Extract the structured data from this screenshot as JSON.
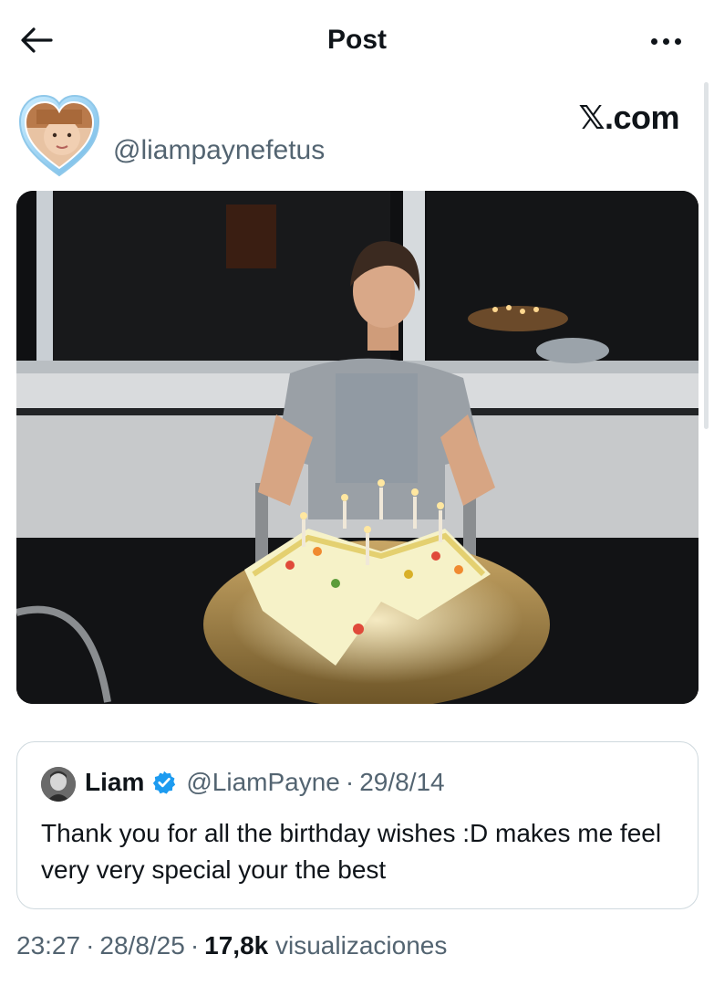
{
  "header": {
    "title": "Post",
    "back_icon": "arrow-left-icon",
    "more_icon": "more-horizontal-icon"
  },
  "author": {
    "handle": "@liampaynefetus",
    "avatar": "heart-frame-avatar"
  },
  "brand": "𝕏.com",
  "photo": {
    "subject": "birthday-cake-photo"
  },
  "quoted_post": {
    "name": "Liam",
    "verified": true,
    "handle": "@LiamPayne",
    "separator": "·",
    "date": "29/8/14",
    "text": "Thank you for all the birthday wishes :D makes me feel very very special your the best"
  },
  "meta": {
    "time": "23:27",
    "separator": "·",
    "date": "28/8/25",
    "views_count": "17,8k",
    "views_label": "visualizaciones"
  },
  "colors": {
    "text_primary": "#0f1419",
    "text_secondary": "#536471",
    "border": "#cfd9de",
    "verified_blue": "#1d9bf0"
  }
}
